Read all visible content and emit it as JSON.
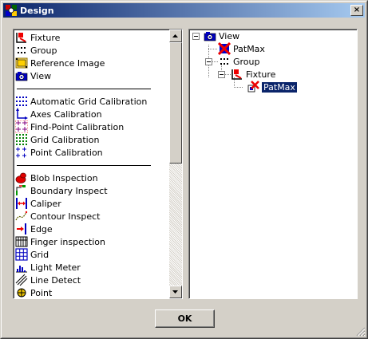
{
  "window": {
    "title": "Design",
    "close_glyph": "×"
  },
  "tool_list": {
    "groups": [
      [
        "Fixture",
        "Group",
        "Reference Image",
        "View"
      ],
      [
        "Automatic Grid Calibration",
        "Axes Calibration",
        "Find-Point Calibration",
        "Grid Calibration",
        "Point Calibration"
      ],
      [
        "Blob Inspection",
        "Boundary Inspect",
        "Caliper",
        "Contour Inspect",
        "Edge",
        "Finger inspection",
        "Grid",
        "Light Meter",
        "Line Detect",
        "Point"
      ]
    ],
    "icons": {
      "Fixture": "fixture-icon",
      "Group": "group-icon",
      "Reference Image": "reference-image-icon",
      "View": "view-camera-icon",
      "Automatic Grid Calibration": "dot-grid-blue-icon",
      "Axes Calibration": "axes-icon",
      "Find-Point Calibration": "find-point-icon",
      "Grid Calibration": "dot-grid-green-icon",
      "Point Calibration": "point-cross-icon",
      "Blob Inspection": "blob-icon",
      "Boundary Inspect": "boundary-icon",
      "Caliper": "caliper-icon",
      "Contour Inspect": "contour-icon",
      "Edge": "edge-icon",
      "Finger inspection": "finger-icon",
      "Grid": "grid-icon",
      "Light Meter": "light-meter-icon",
      "Line Detect": "line-detect-icon",
      "Point": "point-icon"
    }
  },
  "design_tree": {
    "view": "View",
    "patmax_top": "PatMax",
    "group": "Group",
    "fixture": "Fixture",
    "patmax_child": "PatMax"
  },
  "buttons": {
    "ok": "OK"
  },
  "colors": {
    "title_start": "#0a246a",
    "title_end": "#a6caf0",
    "selection": "#0a246a",
    "face": "#d4d0c8"
  }
}
